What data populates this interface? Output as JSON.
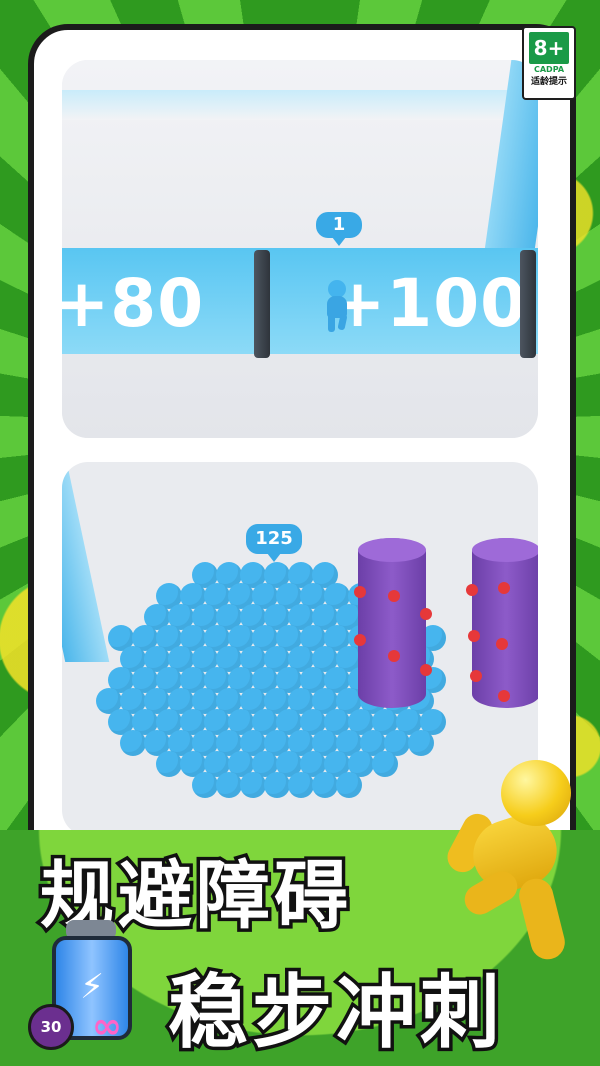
{
  "rating": {
    "age": "8+",
    "org": "CADPA",
    "tip": "适龄提示"
  },
  "scene_top": {
    "gates": [
      "+80",
      "+100"
    ],
    "counter": "1"
  },
  "scene_bottom": {
    "counter": "125"
  },
  "banner": {
    "line1": "规避障碍",
    "line2": "稳步冲刺",
    "badge_number": "30",
    "infinity_symbol": "∞",
    "bolt_symbol": "⚡"
  },
  "colors": {
    "crowd": "#46b5ee",
    "pillar": "#7a48b8",
    "stud": "#e6383a",
    "background_green": "#3fb12a",
    "accent_yellow": "#f6cd1b"
  }
}
